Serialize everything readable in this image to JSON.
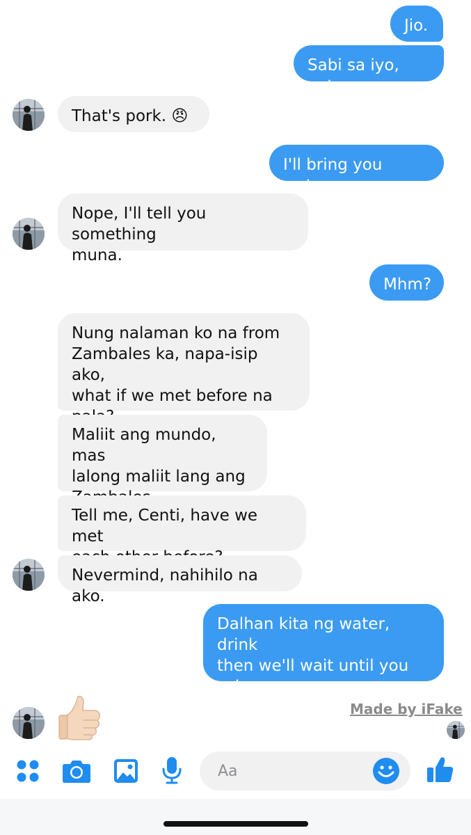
{
  "messages": [
    {
      "side": "out",
      "text": "Jio."
    },
    {
      "side": "out",
      "text": "Sabi sa iyo, eat."
    },
    {
      "side": "in",
      "text": "That's pork. 😠"
    },
    {
      "side": "out",
      "text": "I'll bring you water."
    },
    {
      "side": "in",
      "text": "Nope, I'll tell you something\nmuna."
    },
    {
      "side": "out",
      "text": "Mhm?"
    },
    {
      "side": "in",
      "text": "Nung nalaman ko na from\nZambales ka, napa-isip ako,\nwhat if we met before na\npala?"
    },
    {
      "side": "in",
      "text": "Maliit ang mundo, mas\nlalong maliit lang ang\nZambales."
    },
    {
      "side": "in",
      "text": "Tell me, Centi, have we met\neach other before?"
    },
    {
      "side": "in",
      "text": "Nevermind, nahihilo na ako."
    },
    {
      "side": "out",
      "text": "Dalhan kita ng water, drink\nthen we'll wait until you\nsober up."
    },
    {
      "side": "in",
      "type": "sticker",
      "icon": "thumbs-up-emoji"
    }
  ],
  "watermark": "Made by iFake",
  "composer": {
    "placeholder": "Aa"
  },
  "toolbar": {
    "icons": [
      "apps-icon",
      "camera-icon",
      "gallery-icon",
      "microphone-icon",
      "emoji-icon",
      "like-icon"
    ]
  },
  "colors": {
    "outgoing_bubble": "#3b9bf3",
    "incoming_bubble": "#f1f1f2",
    "accent": "#1f8cf0"
  }
}
